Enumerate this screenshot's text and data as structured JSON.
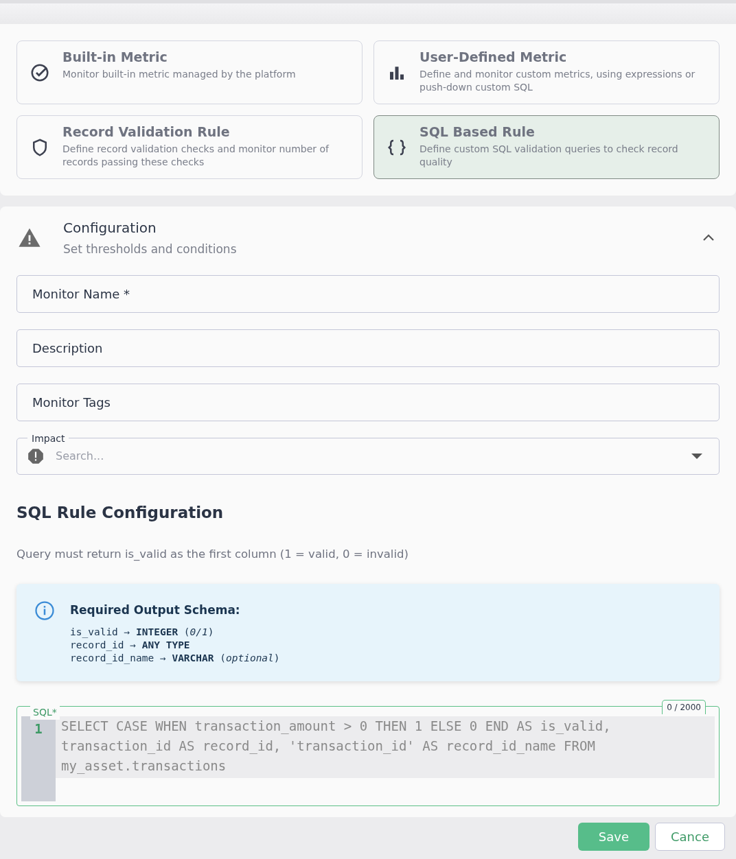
{
  "metric_types": [
    {
      "kind": "builtin",
      "title": "Built-in Metric",
      "description": "Monitor built-in metric managed by the platform",
      "selected": false
    },
    {
      "kind": "user_defined",
      "title": "User-Defined Metric",
      "description": "Define and monitor custom metrics, using expressions or push-down custom SQL",
      "selected": false
    },
    {
      "kind": "record_validation",
      "title": "Record Validation Rule",
      "description": "Define record validation checks and monitor number of records passing these checks",
      "selected": false
    },
    {
      "kind": "sql",
      "title": "SQL Based Rule",
      "description": "Define custom SQL validation queries to check record quality",
      "selected": true
    }
  ],
  "configuration": {
    "title": "Configuration",
    "subtitle": "Set thresholds and conditions",
    "expanded": true,
    "fields": [
      {
        "placeholder": "Monitor Name *"
      },
      {
        "placeholder": "Description"
      },
      {
        "placeholder": "Monitor Tags"
      }
    ],
    "impact": {
      "label": "Impact",
      "placeholder": "Search..."
    },
    "sql_rule": {
      "title": "SQL Rule Configuration",
      "hint": "Query must return is_valid as the first column (1 = valid, 0 = invalid)",
      "schema_title": "Required Output Schema:",
      "schema_lines": [
        "is_valid → **INTEGER** (*0/1*)",
        "record_id → **ANY TYPE**",
        "record_id_name → **VARCHAR** (*optional*)"
      ],
      "sql_label": "SQL*",
      "counter": "0 / 2000",
      "line_number": "1",
      "sql_placeholder": "SELECT CASE WHEN transaction_amount > 0 THEN 1 ELSE 0 END AS is_valid, transaction_id AS record_id, 'transaction_id' AS record_id_name FROM my_asset.transactions"
    }
  },
  "buttons": [
    {
      "kind": "primary",
      "label": "Save"
    },
    {
      "kind": "secondary",
      "label": "Cance"
    }
  ]
}
